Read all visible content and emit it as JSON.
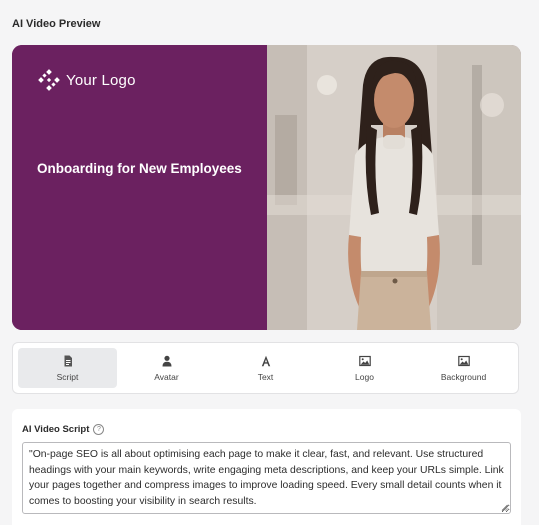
{
  "panel": {
    "title": "AI Video Preview"
  },
  "preview": {
    "logo_text": "Your Logo",
    "video_title": "Onboarding for New Employees",
    "colors": {
      "slide_bg": "#6b2160",
      "text": "#ffffff"
    }
  },
  "tabs": [
    {
      "label": "Script",
      "icon": "document-icon",
      "active": true
    },
    {
      "label": "Avatar",
      "icon": "person-icon",
      "active": false
    },
    {
      "label": "Text",
      "icon": "text-icon",
      "active": false
    },
    {
      "label": "Logo",
      "icon": "image-icon",
      "active": false
    },
    {
      "label": "Background",
      "icon": "image-icon",
      "active": false
    }
  ],
  "script": {
    "heading": "AI Video Script",
    "help_icon": "question-circle-icon",
    "value": "\"On-page SEO is all about optimising each page to make it clear, fast, and relevant. Use structured headings with your main keywords, write engaging meta descriptions, and keep your URLs simple. Link your pages together and compress images to improve loading speed. Every small detail counts when it comes to boosting your visibility in search results."
  }
}
